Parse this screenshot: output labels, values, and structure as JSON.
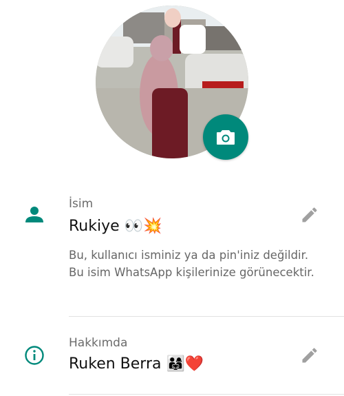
{
  "colors": {
    "accent": "#00897b",
    "icon_gray": "#9e9e9e",
    "label_gray": "#6b6b6b"
  },
  "profile": {
    "photo_icon": "profile-photo",
    "camera_icon": "camera-icon"
  },
  "name_row": {
    "icon": "person-icon",
    "label": "İsim",
    "value": "Rukiye 👀💥",
    "hint": "Bu, kullanıcı isminiz ya da pin'iniz değildir. Bu isim WhatsApp kişilerinize görünecektir.",
    "edit_icon": "pencil-icon"
  },
  "about_row": {
    "icon": "info-icon",
    "label": "Hakkımda",
    "value": "Ruken Berra 👨‍👩‍👧❤️",
    "edit_icon": "pencil-icon"
  }
}
